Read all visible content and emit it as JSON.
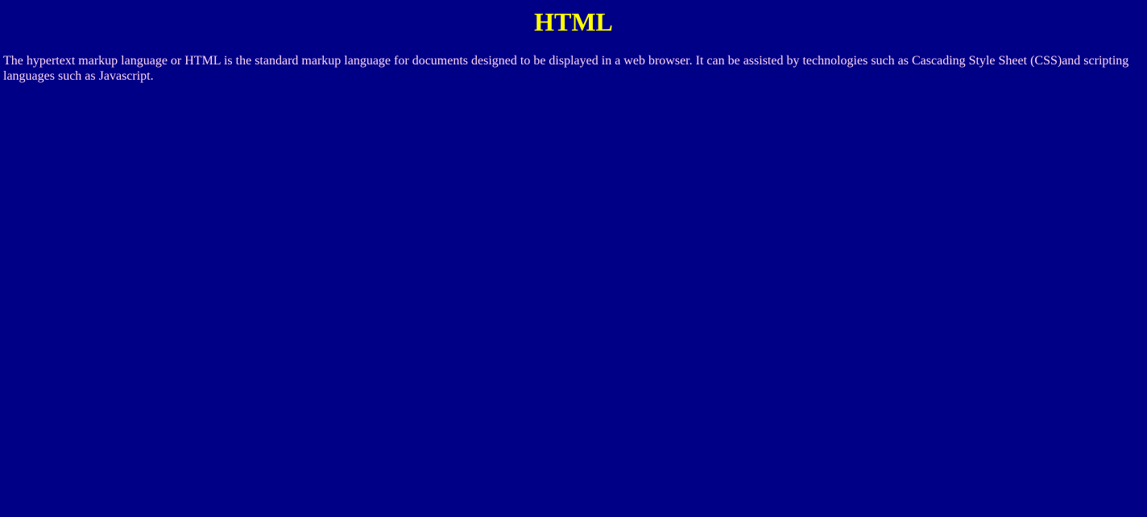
{
  "page": {
    "title": "HTML",
    "description": "The hypertext markup language or HTML is the standard markup language for documents designed to be displayed in a web browser. It can be assisted by technologies such as Cascading Style Sheet (CSS)and scripting languages such as Javascript.",
    "colors": {
      "background": "#000087",
      "title": "#ffff00",
      "body_text": "#ffd6f2"
    }
  }
}
